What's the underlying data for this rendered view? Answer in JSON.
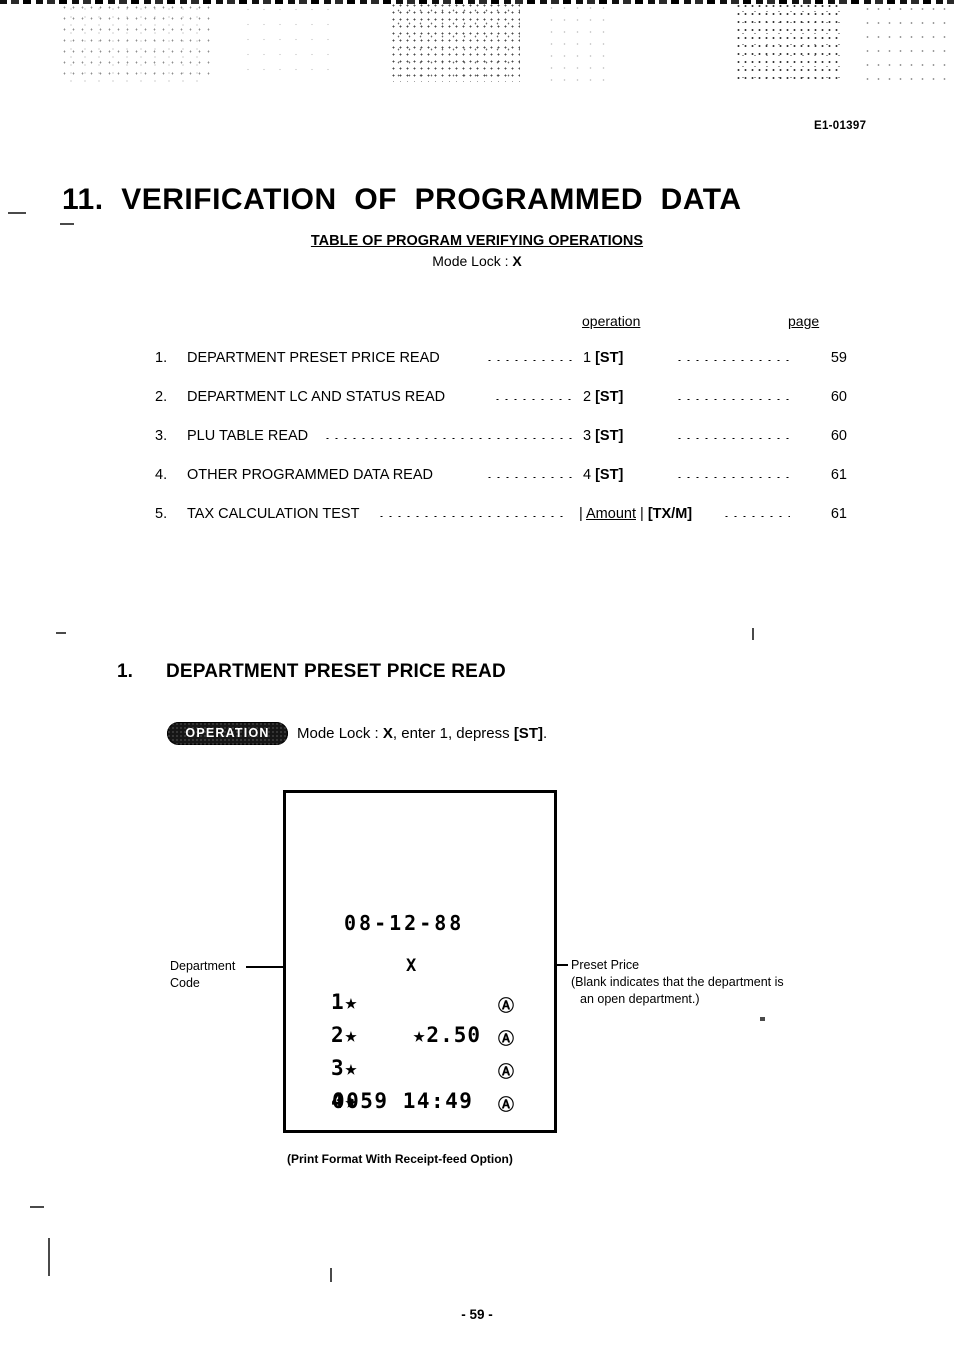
{
  "document": {
    "code": "E1-01397",
    "page_number": "- 59 -"
  },
  "main_title": "11.  VERIFICATION  OF  PROGRAMMED  DATA",
  "table": {
    "caption": "TABLE OF PROGRAM VERIFYING OPERATIONS",
    "mode_lock_prefix": "Mode Lock : ",
    "mode_lock_value": "X",
    "headers": {
      "operation": "operation",
      "page": "page"
    },
    "rows": [
      {
        "num": "1.",
        "label": "DEPARTMENT PRESET PRICE READ",
        "key_prefix": "1 ",
        "key": "[ST]",
        "page": "59"
      },
      {
        "num": "2.",
        "label": "DEPARTMENT LC AND STATUS READ",
        "key_prefix": "2 ",
        "key": "[ST]",
        "page": "60"
      },
      {
        "num": "3.",
        "label": "PLU TABLE READ",
        "key_prefix": "3 ",
        "key": "[ST]",
        "page": "60"
      },
      {
        "num": "4.",
        "label": "OTHER PROGRAMMED DATA READ",
        "key_prefix": "4 ",
        "key": "[ST]",
        "page": "61"
      },
      {
        "num": "5.",
        "label": "TAX CALCULATION TEST",
        "key_prefix": "| ",
        "key_underlined": "Amount",
        "key_mid": " | ",
        "key": "[TX/M]",
        "page": "61"
      }
    ]
  },
  "section": {
    "num": "1.",
    "title": "DEPARTMENT PRESET PRICE READ",
    "badge_label": "OPERATION",
    "operation_desc_pre": "Mode Lock : ",
    "operation_desc_bold1": "X",
    "operation_desc_mid": ", enter 1, depress ",
    "operation_desc_bold2": "[ST]",
    "operation_desc_end": "."
  },
  "receipt": {
    "date": "08-12-88",
    "x_marker": "X",
    "lines": [
      {
        "code": "1★",
        "price": "",
        "status": "Ⓐ"
      },
      {
        "code": "2★",
        "price": "★2.50",
        "status": "Ⓐ"
      },
      {
        "code": "3★",
        "price": "",
        "status": "Ⓐ"
      },
      {
        "code": "4★",
        "price": "",
        "status": "Ⓐ"
      }
    ],
    "footer": "0059 14:49",
    "caption": "(Print Format With Receipt-feed Option)"
  },
  "annotations": {
    "left_line1": "Department",
    "left_line2": "Code",
    "right_line1": "Preset Price",
    "right_line2": "(Blank indicates that the department is",
    "right_line3": "an open department.)"
  }
}
